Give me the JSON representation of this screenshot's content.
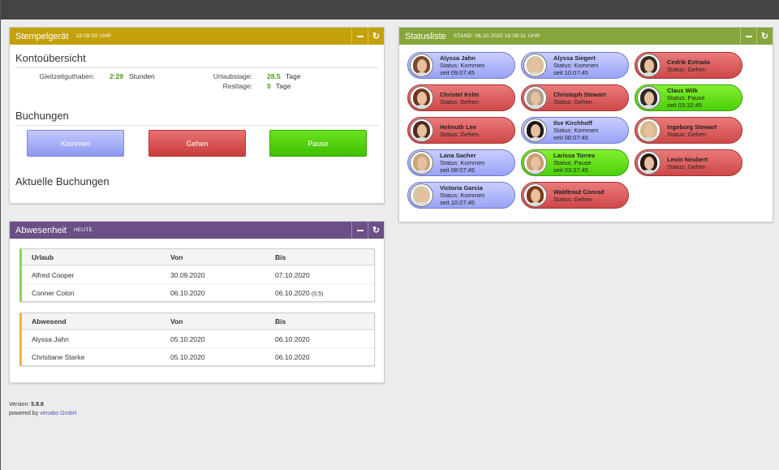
{
  "stempel": {
    "title": "Stempelgerät",
    "time": "18:08:00 UHR",
    "konto_title": "Kontoübersicht",
    "gleitzeit_label": "Gleitzeitguthaben:",
    "gleitzeit_value": "2:29",
    "gleitzeit_unit": "Stunden",
    "urlaub_label": "Urlaubstage:",
    "urlaub_value": "28.5",
    "urlaub_unit": "Tage",
    "rest_label": "Resttage:",
    "rest_value": "0",
    "rest_unit": "Tage",
    "buchungen_title": "Buchungen",
    "btn_kommen": "Kommen",
    "btn_gehen": "Gehen",
    "btn_pause": "Pause",
    "aktuelle_title": "Aktuelle Buchungen"
  },
  "status": {
    "title": "Statusliste",
    "stand": "STAND: 06.10.2020 18:08:31 UHR",
    "people": [
      {
        "name": "Alyssa Jahn",
        "status": "Status: Kommen",
        "since": "seit 09:07:45",
        "state": "kommen",
        "hair": "#7a4a2a"
      },
      {
        "name": "Alyssa Siegert",
        "status": "Status: Kommen",
        "since": "seit 10:07:45",
        "state": "kommen",
        "hair": "#d8c39a"
      },
      {
        "name": "Cedrik Estrada",
        "status": "Status: Gehen",
        "since": "",
        "state": "gehen",
        "hair": "#3a2a22"
      },
      {
        "name": "Christel Kelm",
        "status": "Status: Gehen",
        "since": "",
        "state": "gehen",
        "hair": "#6a3a20"
      },
      {
        "name": "Christoph Stewart",
        "status": "Status: Gehen",
        "since": "",
        "state": "gehen",
        "hair": "#b0a090"
      },
      {
        "name": "Claus Wilk",
        "status": "Status: Pause",
        "since": "seit 03:32:45",
        "state": "pause",
        "hair": "#2a2a2a"
      },
      {
        "name": "Helmuth Lee",
        "status": "Status: Gehen",
        "since": "",
        "state": "gehen",
        "hair": "#4a3020"
      },
      {
        "name": "Ilse Kirchhoff",
        "status": "Status: Kommen",
        "since": "seit 08:07:45",
        "state": "kommen",
        "hair": "#1a1a1a"
      },
      {
        "name": "Ingeborg Stewart",
        "status": "Status: Gehen",
        "since": "",
        "state": "gehen",
        "hair": "#d9b98a"
      },
      {
        "name": "Lana Sacher",
        "status": "Status: Kommen",
        "since": "seit 08:07:45",
        "state": "kommen",
        "hair": "#c9a77a"
      },
      {
        "name": "Larissa Torres",
        "status": "Status: Pause",
        "since": "seit 03:37:45",
        "state": "pause",
        "hair": "#c8a070"
      },
      {
        "name": "Levin Neubert",
        "status": "Status: Gehen",
        "since": "",
        "state": "gehen",
        "hair": "#2a1a12"
      },
      {
        "name": "Victoria Garcia",
        "status": "Status: Kommen",
        "since": "seit 10:07:45",
        "state": "kommen",
        "hair": "#d8c8a8"
      },
      {
        "name": "Waldtraut Conrad",
        "status": "Status: Gehen",
        "since": "",
        "state": "gehen",
        "hair": "#7a3a1a"
      }
    ]
  },
  "abwesenheit": {
    "title": "Abwesenheit",
    "sub": "HEUTE",
    "urlaub": {
      "headers": [
        "Urlaub",
        "Von",
        "Bis"
      ],
      "rows": [
        {
          "name": "Alfred Cooper",
          "von": "30.09.2020",
          "bis": "07.10.2020",
          "note": ""
        },
        {
          "name": "Conner Colon",
          "von": "06.10.2020",
          "bis": "06.10.2020",
          "note": "(0,5)"
        }
      ]
    },
    "abwesend": {
      "headers": [
        "Abwesend",
        "Von",
        "Bis"
      ],
      "rows": [
        {
          "name": "Alyssa Jahn",
          "von": "05.10.2020",
          "bis": "06.10.2020",
          "note": ""
        },
        {
          "name": "Christiane Starke",
          "von": "05.10.2020",
          "bis": "06.10.2020",
          "note": ""
        }
      ]
    }
  },
  "footer": {
    "version_label": "Version:",
    "version": "5.8.8",
    "powered_label": "powered by",
    "company": "venabo GmbH"
  }
}
